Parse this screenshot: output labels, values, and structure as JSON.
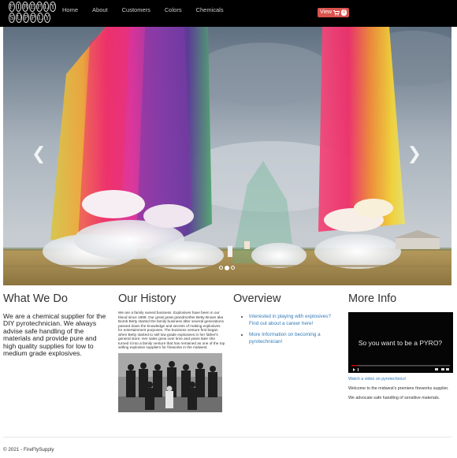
{
  "brand": {
    "logo_text_line1": "FIREFLY",
    "logo_text_line2": "SUPPLY",
    "logo_letters_1": [
      "F",
      "I",
      "R",
      "E",
      "F",
      "L",
      "Y"
    ],
    "logo_letters_2": [
      "S",
      "U",
      "P",
      "P",
      "L",
      "Y"
    ]
  },
  "nav": {
    "items": [
      {
        "label": "Home"
      },
      {
        "label": "About"
      },
      {
        "label": "Customers"
      },
      {
        "label": "Colors"
      },
      {
        "label": "Chemicals"
      }
    ],
    "cart_label": "View",
    "cart_icon": "shopping-cart-icon",
    "cart_count": "0"
  },
  "carousel": {
    "prev_icon": "chevron-left-icon",
    "next_icon": "chevron-right-icon",
    "slide_count": 3,
    "active_slide": 2
  },
  "sections": {
    "what_we_do": {
      "title": "What We Do",
      "text": "We are a chemical supplier for the DIY pyrotechnician. We always advise safe handling of the materials and provide pure and high quality supplies for low to medium grade explosives."
    },
    "our_history": {
      "title": "Our History",
      "text": "We are a family owned business. Explosives have been in our blood since 1898. Our great great grandmother Betty Brown aka Bomb Betty started the family business after several generations passed down the knowledge and secrets of making explosives for entertainment purposes. The business venture first began when Betty started to sell low grade explosives in her father's general store. Her sales grew over time and years later she turned it into a family venture that has remained as one of the top selling explosive suppliers for fireworks in the midwest."
    },
    "overview": {
      "title": "Overview",
      "links": [
        "Interested in playing with explosives? Find out about a career here!",
        "More Information on becoming a pyrotechnician!"
      ]
    },
    "more_info": {
      "title": "More Info",
      "video_title": "So you want to be a PYRO?",
      "video_link": "Watch a video on pyrotechnics!",
      "paragraphs": [
        "Welcome to the midwest's premiere fireworks supplier.",
        "We advocate safe handling of sensitive materials."
      ]
    }
  },
  "footer": {
    "text": "© 2021 - FireFlySupply"
  },
  "colors": {
    "navbar": "#000000",
    "cart_button": "#d9534f",
    "link": "#337ab7"
  }
}
